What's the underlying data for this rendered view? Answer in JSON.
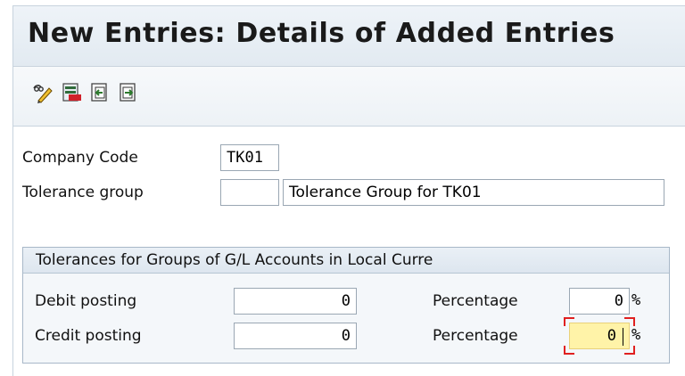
{
  "title": "New Entries: Details of Added Entries",
  "toolbar": {
    "icons": [
      "display-change-icon",
      "delete-icon",
      "previous-entry-icon",
      "next-entry-icon"
    ]
  },
  "company_code": {
    "label": "Company Code",
    "value": "TK01"
  },
  "tolerance_group": {
    "label": "Tolerance group",
    "value": "",
    "description": "Tolerance Group for TK01"
  },
  "tolerances": {
    "title": "Tolerances for Groups of G/L Accounts in Local Curre",
    "debit": {
      "label": "Debit posting",
      "value": "0",
      "pct_label": "Percentage",
      "pct_value": "0",
      "pct_unit": "%"
    },
    "credit": {
      "label": "Credit posting",
      "value": "0",
      "pct_label": "Percentage",
      "pct_value": "0",
      "pct_unit": "%"
    }
  },
  "colors": {
    "focus": "#fff3a8",
    "focus_frame": "#e02020"
  }
}
